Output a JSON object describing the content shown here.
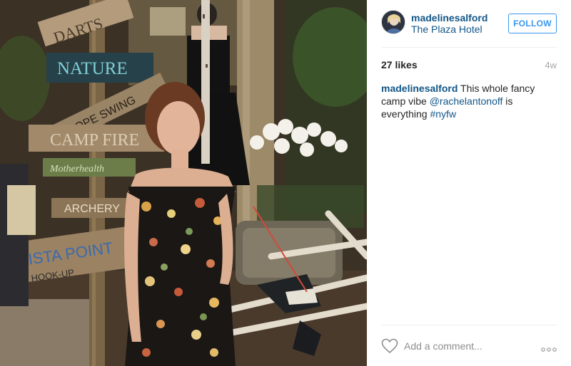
{
  "post": {
    "image_alt": "Woman in floral off-shoulder dress among camp-style wooden signs"
  },
  "signs": {
    "darts": "DARTS",
    "nature": "NATURE",
    "rope_swing": "ROPE SWING",
    "camp_fire": "CAMP FIRE",
    "mother_health": "Motherhealth",
    "archery": "ARCHERY",
    "vista_point": "VISTA POINT",
    "hook_up": "HOOK-UP"
  },
  "header": {
    "username": "madelinesalford",
    "location": "The Plaza Hotel",
    "follow_label": "FOLLOW"
  },
  "stats": {
    "likes": "27 likes",
    "age": "4w"
  },
  "caption": {
    "username": "madelinesalford",
    "text_part1": " This whole fancy camp vibe ",
    "mention": "@rachelantonoff",
    "text_part2": " is everything ",
    "hashtag": "#nyfw"
  },
  "comment": {
    "placeholder": "Add a comment..."
  },
  "colors": {
    "link": "#125688",
    "follow": "#3897f0",
    "muted": "#a5a7aa"
  }
}
